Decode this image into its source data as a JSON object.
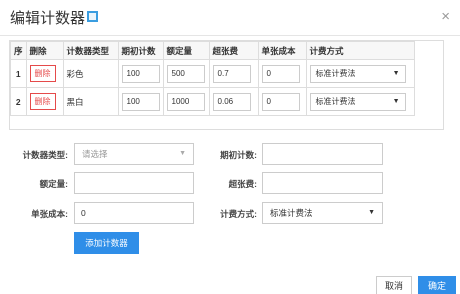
{
  "dialog": {
    "title": "编辑计数器",
    "close": "×"
  },
  "table": {
    "headers": [
      "序",
      "删除",
      "计数器类型",
      "期初计数",
      "额定量",
      "超张费",
      "单张成本",
      "计费方式"
    ],
    "rows": [
      {
        "index": "1",
        "delete": "删除",
        "type": "彩色",
        "initial": "100",
        "quota": "500",
        "overage": "0.7",
        "cost": "0",
        "billing": "标准计费法"
      },
      {
        "index": "2",
        "delete": "删除",
        "type": "黑白",
        "initial": "100",
        "quota": "1000",
        "overage": "0.06",
        "cost": "0",
        "billing": "标准计费法"
      }
    ]
  },
  "form": {
    "type_label": "计数器类型:",
    "type_placeholder": "请选择",
    "initial_label": "期初计数:",
    "initial_value": "",
    "quota_label": "额定量:",
    "quota_value": "",
    "overage_label": "超张费:",
    "overage_value": "",
    "cost_label": "单张成本:",
    "cost_value": "0",
    "billing_label": "计费方式:",
    "billing_value": "标准计费法",
    "add_button": "添加计数器"
  },
  "footer": {
    "cancel": "取消",
    "ok": "确定"
  },
  "icons": {
    "select_arrow": "▼"
  },
  "colors": {
    "primary": "#2f8ee8",
    "danger": "#e54a4a"
  }
}
